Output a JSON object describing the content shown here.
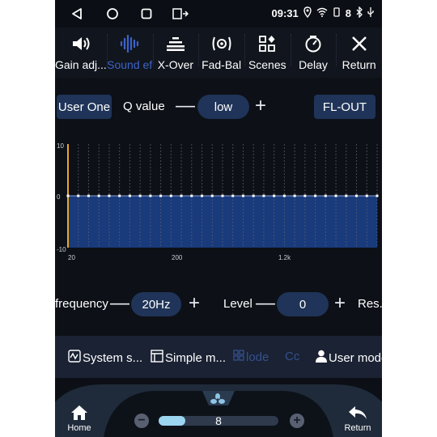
{
  "status": {
    "time": "09:31",
    "battery_level": "8"
  },
  "tabs": [
    {
      "label": "Gain adj...",
      "icon": "speaker-volume-icon"
    },
    {
      "label": "Sound ef",
      "icon": "waveform-icon"
    },
    {
      "label": "X-Over",
      "icon": "xover-icon"
    },
    {
      "label": "Fad-Bal",
      "icon": "fader-balance-icon"
    },
    {
      "label": "Scenes",
      "icon": "scenes-icon"
    },
    {
      "label": "Delay",
      "icon": "delay-timer-icon"
    },
    {
      "label": "Return",
      "icon": "close-icon"
    }
  ],
  "active_tab": "Sound ef",
  "controls": {
    "preset_label": "User One",
    "q_label": "Q value",
    "q_value": "low",
    "channel_label": "FL-OUT"
  },
  "eq": {
    "y_ticks": [
      "10",
      "0",
      "-10"
    ],
    "x_ticks": [
      "20",
      "200",
      "1.2k"
    ],
    "ylim": [
      -10,
      10
    ],
    "band_count": 31,
    "band_levels": [
      0,
      0,
      0,
      0,
      0,
      0,
      0,
      0,
      0,
      0,
      0,
      0,
      0,
      0,
      0,
      0,
      0,
      0,
      0,
      0,
      0,
      0,
      0,
      0,
      0,
      0,
      0,
      0,
      0,
      0,
      0
    ],
    "selected_band": 0
  },
  "band": {
    "frequency_label": "frequency",
    "frequency_value": "20Hz",
    "level_label": "Level",
    "level_value": "0",
    "reset_label": "Res..."
  },
  "submenu": [
    {
      "label": "System s...",
      "icon": "system-settings-icon",
      "dim": false
    },
    {
      "label": "Simple m...",
      "icon": "simple-mode-icon",
      "dim": false
    },
    {
      "label": "lode",
      "icon": "grid-mode-icon",
      "dim": true
    },
    {
      "label": "Cc",
      "icon": "",
      "dim": true
    },
    {
      "label": "User mode",
      "icon": "user-icon",
      "dim": false
    }
  ],
  "dock": {
    "home_label": "Home",
    "return_label": "Return",
    "volume_value": "8",
    "volume_fraction": 0.22
  },
  "colors": {
    "accent": "#3c63c8",
    "pill": "#1f3458",
    "eq_fill": "#1b3f86",
    "selected_band": "#e8a72c"
  }
}
